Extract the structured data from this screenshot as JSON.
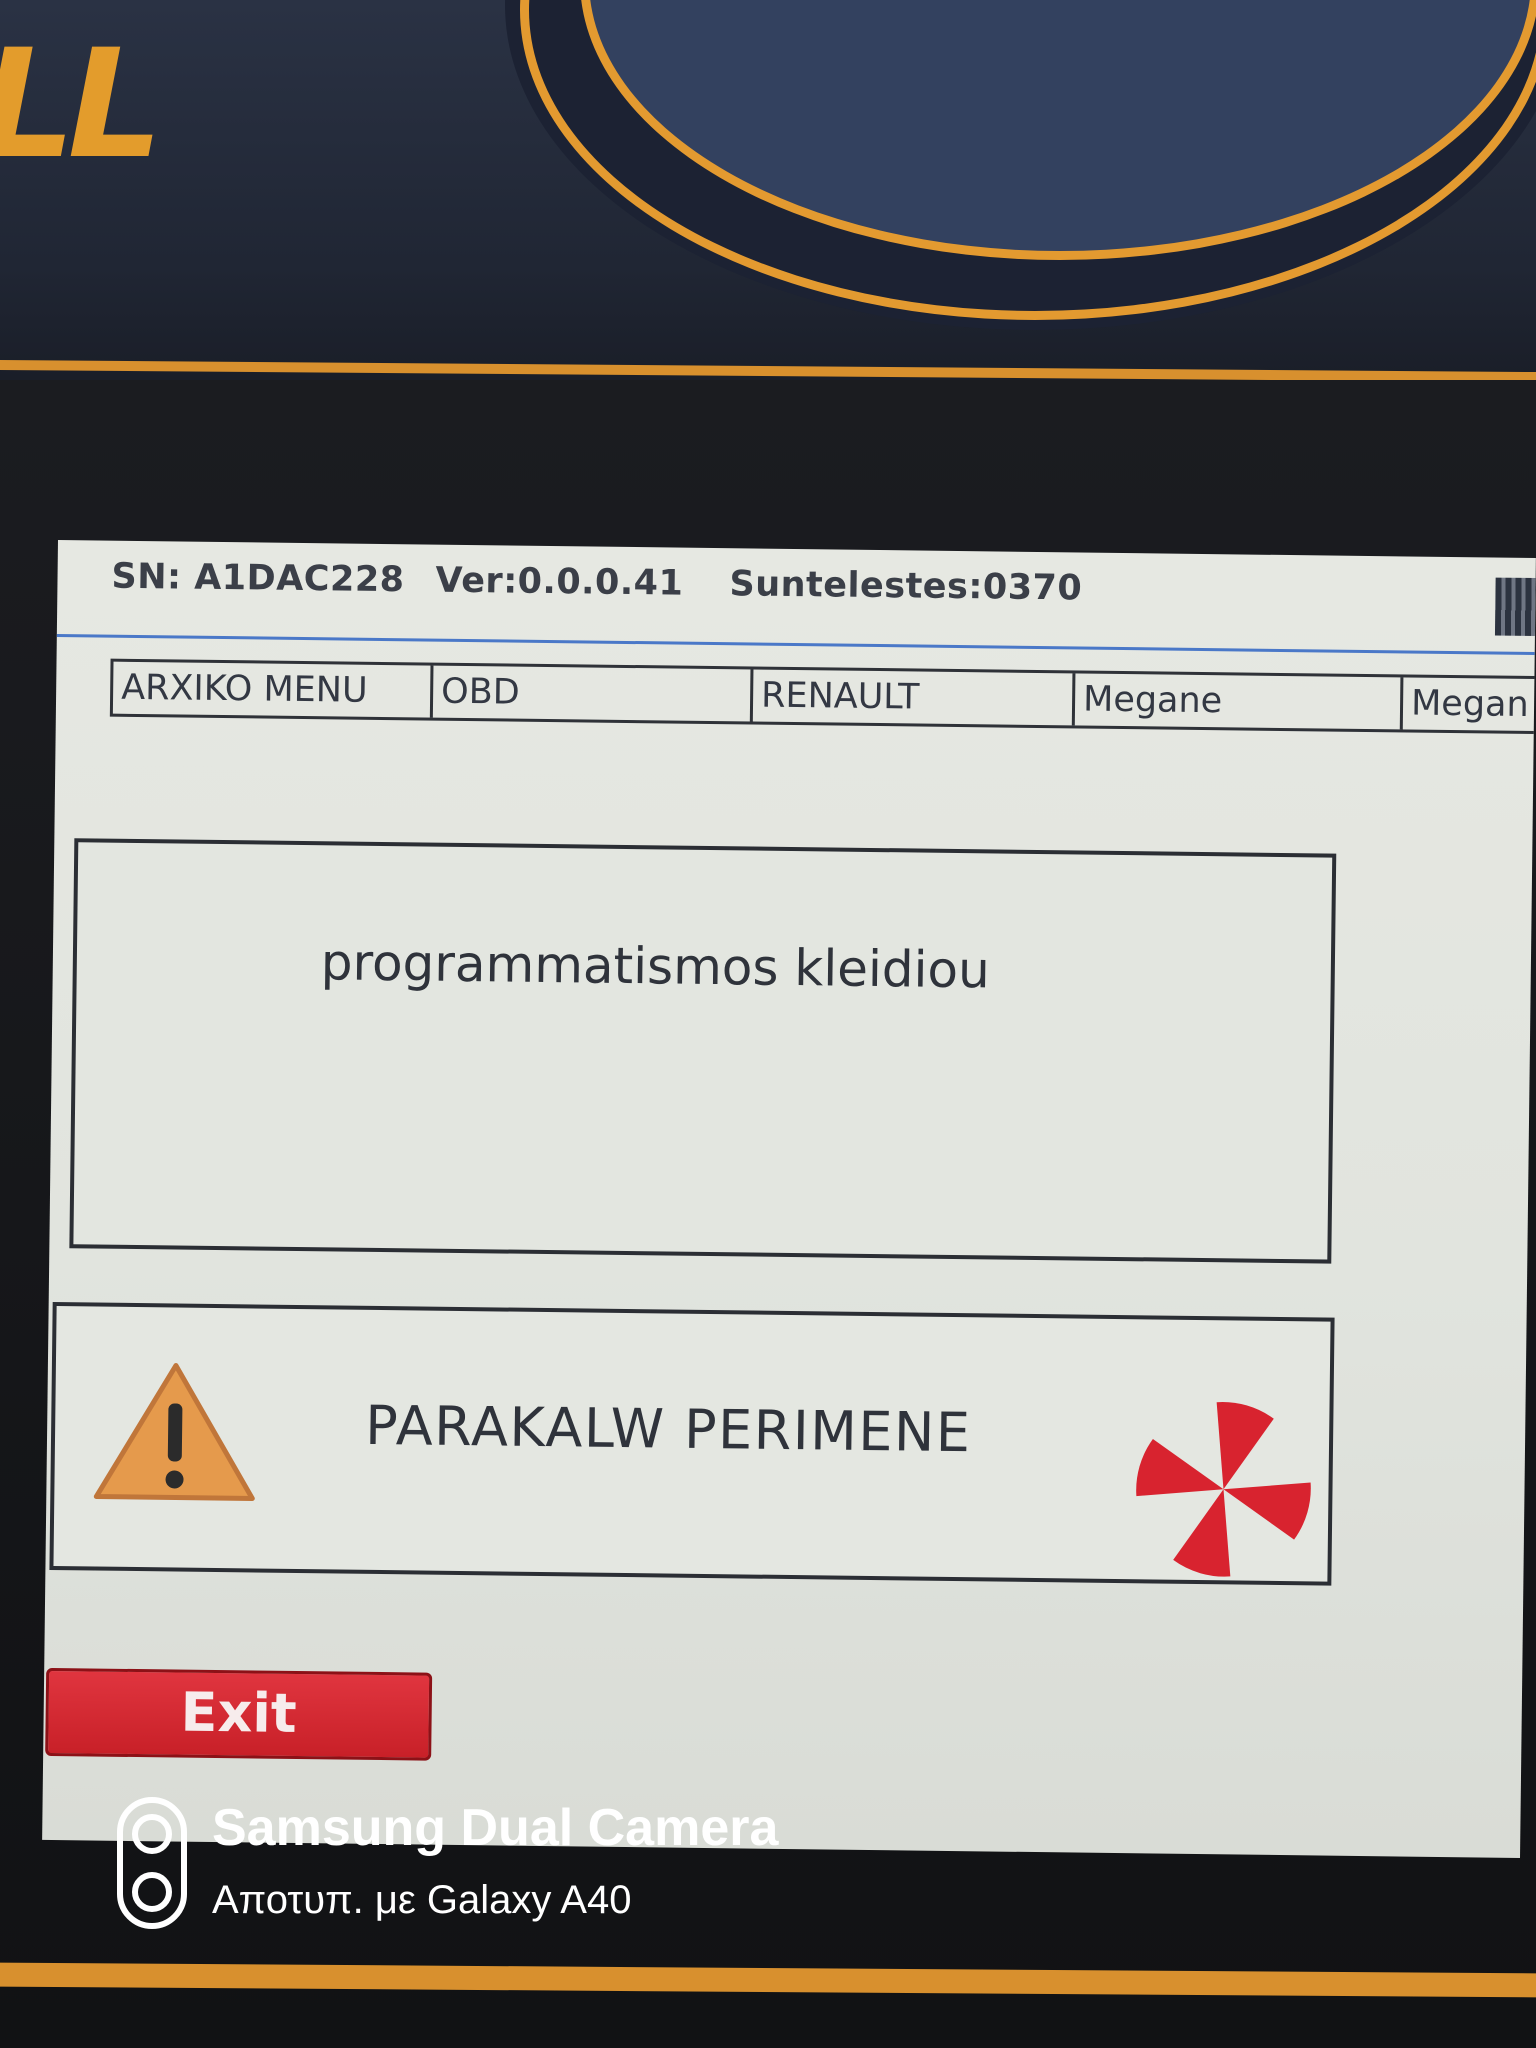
{
  "device": {
    "brand_text": "LL",
    "accent_color": "#e39c2c"
  },
  "status_bar": {
    "serial": "SN: A1DAC228",
    "version": "Ver:0.0.0.41",
    "suntelestes": "Suntelestes:0370"
  },
  "breadcrumb": {
    "items": [
      "ARXIKO MENU",
      "OBD",
      "RENAULT",
      "Megane",
      "Megan"
    ]
  },
  "message": {
    "text": "programmatismos kleidiou"
  },
  "wait": {
    "text": "PARAKALW PERIMENE",
    "warning_icon": "warning-triangle-icon",
    "spinner_icon": "loading-spinner-icon",
    "spinner_color": "#d8232f"
  },
  "exit_button": {
    "label": "Exit",
    "color": "#d42a33"
  },
  "watermark": {
    "title": "Samsung Dual Camera",
    "subtitle": "Αποτυπ. με Galaxy A40"
  }
}
